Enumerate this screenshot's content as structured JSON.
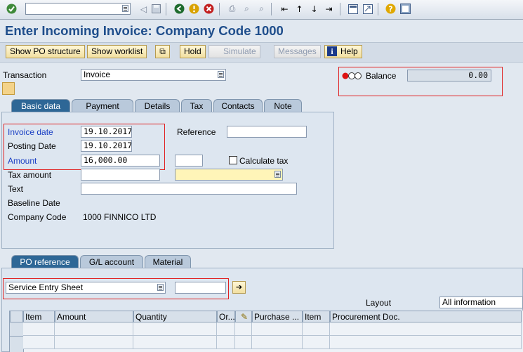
{
  "toolbar": {
    "command_field_value": "",
    "icons": [
      "enter-icon",
      "back-icon",
      "exit-icon",
      "cancel-icon",
      "print-icon",
      "find-icon",
      "find-next-icon",
      "first-page-icon",
      "previous-page-icon",
      "next-page-icon",
      "last-page-icon",
      "new-session-icon",
      "shortcut-icon",
      "help-icon",
      "customize-layout-icon"
    ]
  },
  "page": {
    "title": "Enter Incoming Invoice: Company Code 1000"
  },
  "appbar": {
    "show_po_structure": "Show PO structure",
    "show_worklist": "Show worklist",
    "hold": "Hold",
    "simulate": "Simulate",
    "messages": "Messages",
    "help": "Help"
  },
  "header": {
    "transaction_label": "Transaction",
    "transaction_value": "Invoice",
    "balance_label": "Balance",
    "balance_value": "0.00"
  },
  "tabs": [
    "Basic data",
    "Payment",
    "Details",
    "Tax",
    "Contacts",
    "Note"
  ],
  "basic": {
    "invoice_date_label": "Invoice date",
    "invoice_date_value": "19.10.2017",
    "posting_date_label": "Posting Date",
    "posting_date_value": "19.10.2017",
    "amount_label": "Amount",
    "amount_value": "16,000.00",
    "currency_value": "",
    "calculate_tax_label": "Calculate tax",
    "tax_amount_label": "Tax amount",
    "tax_amount_value": "",
    "tax_code_value": "",
    "text_label": "Text",
    "text_value": "",
    "baseline_date_label": "Baseline Date",
    "company_code_label": "Company Code",
    "company_code_value": "1000 FINNICO LTD",
    "reference_label": "Reference",
    "reference_value": ""
  },
  "lower_tabs": [
    "PO reference",
    "G/L account",
    "Material"
  ],
  "po": {
    "reference_type": "Service Entry Sheet",
    "reference_number": "",
    "layout_label": "Layout",
    "layout_value": "All information"
  },
  "grid": {
    "columns": [
      "Item",
      "Amount",
      "Quantity",
      "Or...",
      "",
      "Purchase ...",
      "Item",
      "Procurement Doc."
    ]
  },
  "colors": {
    "title": "#1f4e8c",
    "active_tab": "#2e6796",
    "highlight": "#e02020"
  }
}
